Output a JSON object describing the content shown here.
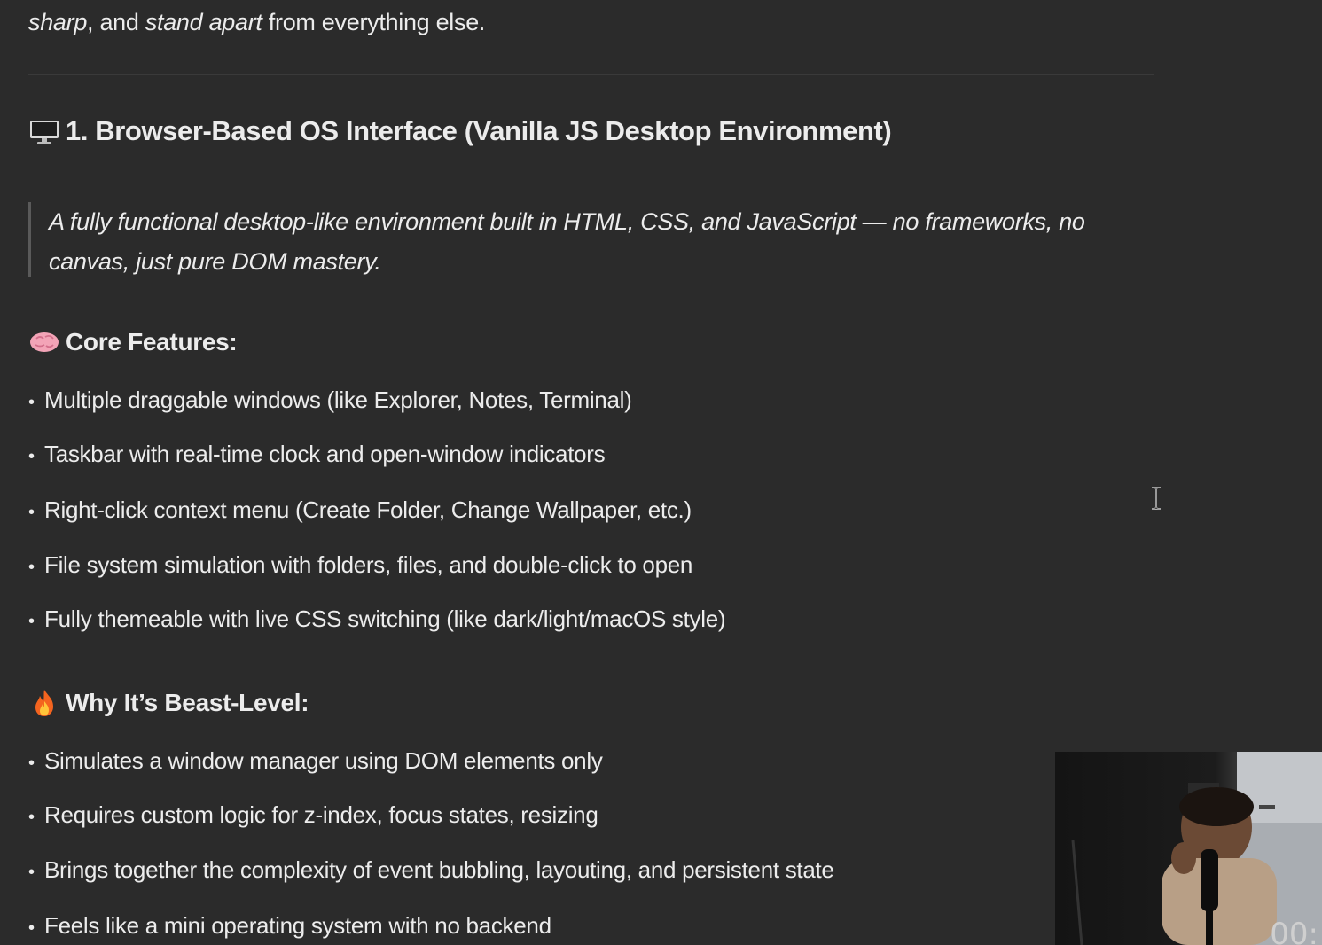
{
  "intro": {
    "part1": "sharp",
    "part2": ", and ",
    "part3": "stand apart",
    "part4": " from everything else."
  },
  "section": {
    "heading_icon": "desktop-computer-icon",
    "heading": "1. Browser-Based OS Interface (Vanilla JS Desktop Environment)",
    "quote": "A fully functional desktop-like environment built in HTML, CSS, and JavaScript — no frameworks, no canvas, just pure DOM mastery."
  },
  "core_features": {
    "icon": "brain-icon",
    "heading": "Core Features:",
    "items": [
      "Multiple draggable windows (like Explorer, Notes, Terminal)",
      "Taskbar with real-time clock and open-window indicators",
      "Right-click context menu (Create Folder, Change Wallpaper, etc.)",
      "File system simulation with folders, files, and double-click to open",
      "Fully themeable with live CSS switching (like dark/light/macOS style)"
    ]
  },
  "why": {
    "icon": "fire-icon",
    "heading": "Why It’s Beast-Level:",
    "items": [
      "Simulates a window manager using DOM elements only",
      "Requires custom logic for z-index, focus states, resizing",
      "Brings together the complexity of event bubbling, layouting, and persistent state",
      "Feels like a mini operating system with no backend"
    ]
  },
  "bullet_char": "•",
  "webcam": {
    "timer": "00:"
  },
  "colors": {
    "background": "#2b2b2b",
    "text": "#ececec",
    "quote_border": "#5a5a5a"
  }
}
